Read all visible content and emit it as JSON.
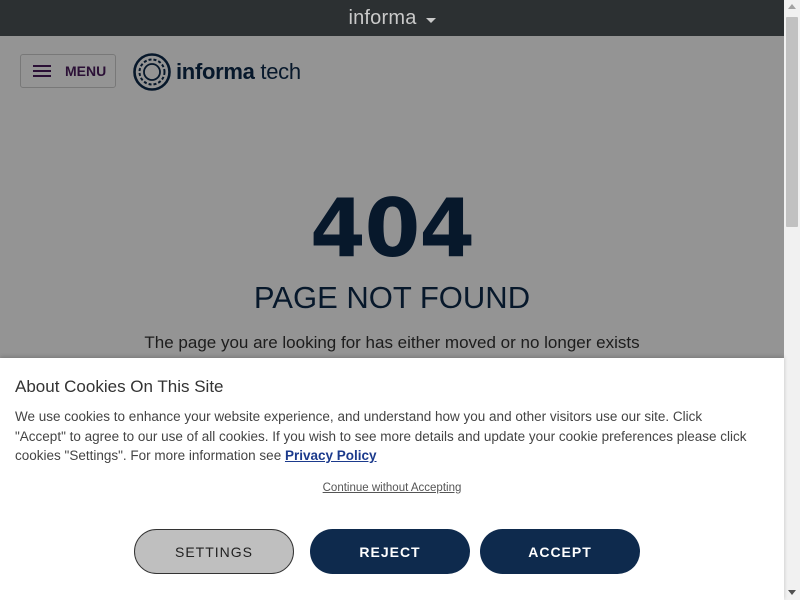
{
  "top_bar": {
    "brand": "informa"
  },
  "header": {
    "menu_label": "MENU",
    "logo_text_bold": "informa",
    "logo_text_rest": "tech"
  },
  "error": {
    "code": "404",
    "title": "PAGE NOT FOUND",
    "description": "The page you are looking for has either moved or no longer exists"
  },
  "cookie_banner": {
    "title": "About Cookies On This Site",
    "text": "We use cookies to enhance your website experience, and understand how you and other visitors use our site. Click \"Accept\" to agree to our use of all cookies. If you wish to see more details and update your cookie preferences please click cookies \"Settings\". For more information see",
    "policy_link": "Privacy Policy",
    "continue_link": "Continue without Accepting",
    "buttons": {
      "settings": "SETTINGS",
      "reject": "REJECT",
      "accept": "ACCEPT"
    }
  },
  "colors": {
    "navy": "#0d2a4a",
    "button_navy": "#0e2a4d",
    "top_bar_bg": "#2c3032",
    "menu_purple": "#4a1d5d",
    "link_blue": "#1b3a8c"
  },
  "icons": [
    "caret-down-icon",
    "hamburger-icon",
    "informa-tech-logo-icon"
  ]
}
